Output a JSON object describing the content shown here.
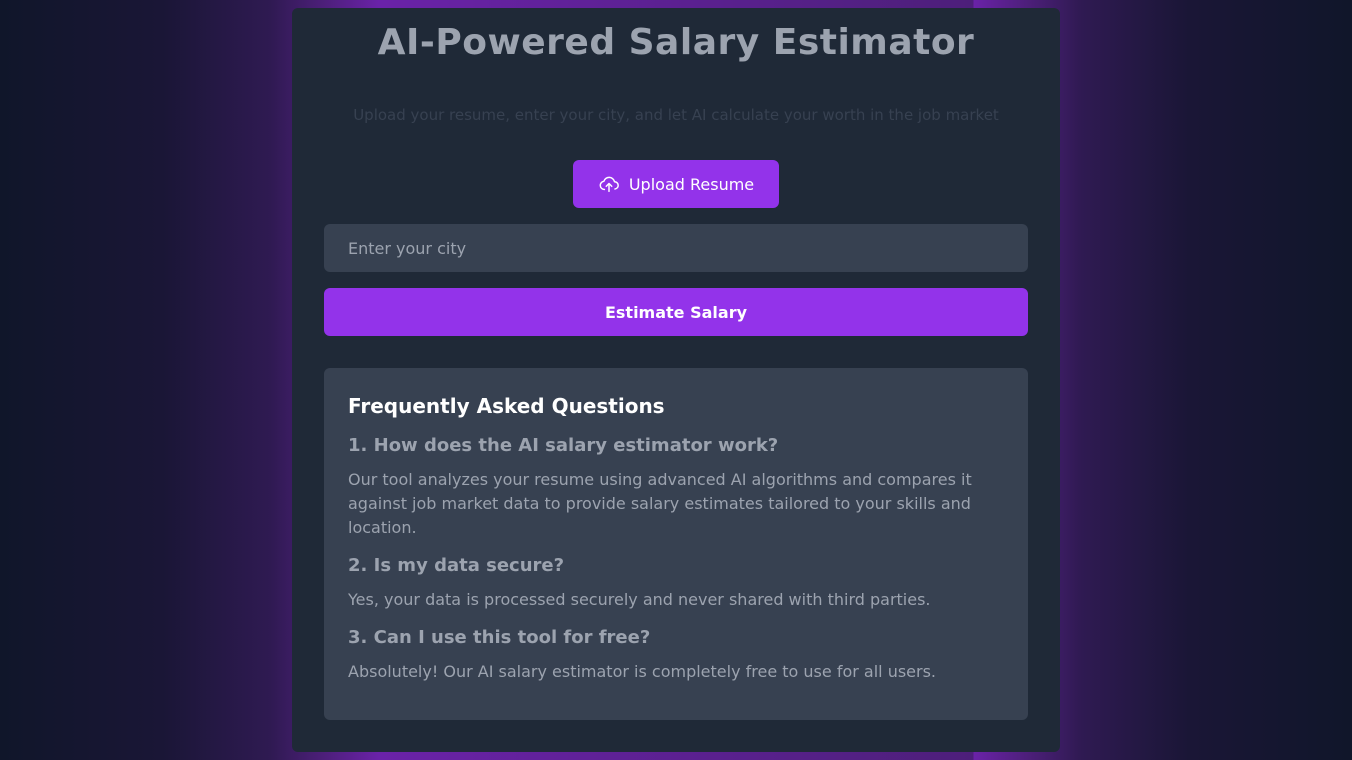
{
  "header": {
    "title": "AI-Powered Salary Estimator",
    "subtitle": "Upload your resume, enter your city, and let AI calculate your worth in the job market"
  },
  "upload": {
    "label": "Upload Resume",
    "icon": "cloud-upload-icon"
  },
  "city": {
    "value": "",
    "placeholder": "Enter your city"
  },
  "estimate": {
    "label": "Estimate Salary"
  },
  "faq": {
    "heading": "Frequently Asked Questions",
    "items": [
      {
        "question": "1. How does the AI salary estimator work?",
        "answer": "Our tool analyzes your resume using advanced AI algorithms and compares it against job market data to provide salary estimates tailored to your skills and location."
      },
      {
        "question": "2. Is my data secure?",
        "answer": "Yes, your data is processed securely and never shared with third parties."
      },
      {
        "question": "3. Can I use this tool for free?",
        "answer": "Absolutely! Our AI salary estimator is completely free to use for all users."
      }
    ]
  },
  "colors": {
    "accent": "#9333ea",
    "card": "#1f2937",
    "panel": "#374151"
  }
}
